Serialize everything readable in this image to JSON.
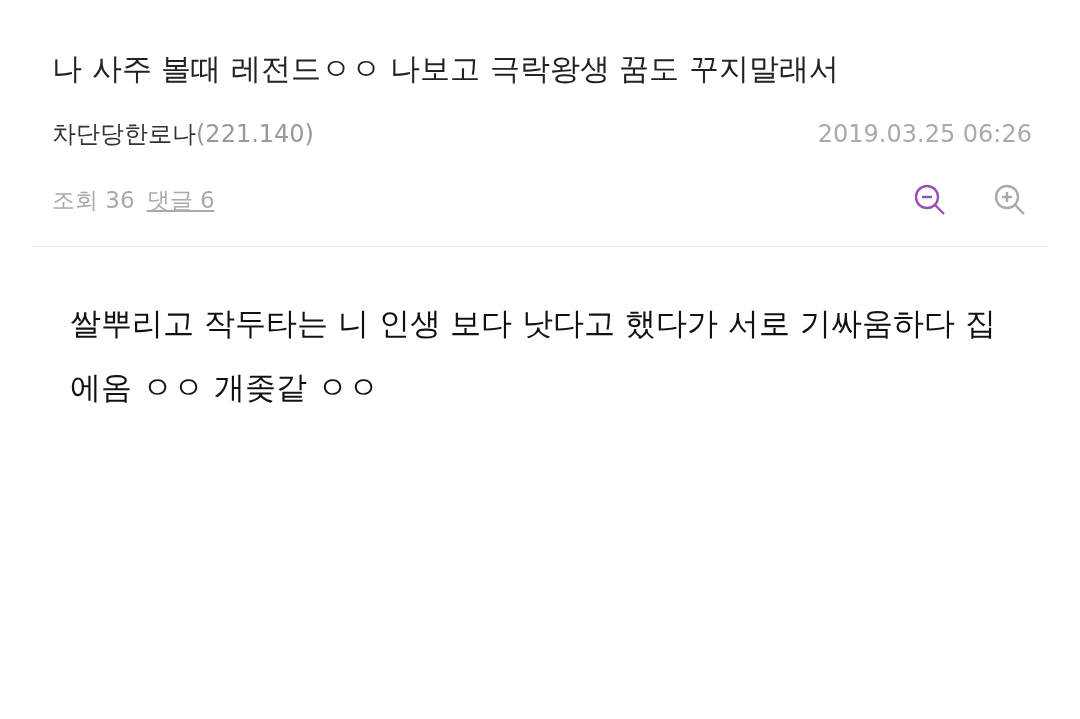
{
  "post": {
    "title": "나 사주 볼때 레전드ㅇㅇ 나보고 극락왕생 꿈도 꾸지말래서",
    "author": "차단당한로나",
    "ip": "(221.140)",
    "date": "2019.03.25 06:26",
    "views_label": "조회 36",
    "comments_link": "댓글 6",
    "body": "쌀뿌리고 작두타는 니 인생 보다 낫다고 했다가 서로 기싸움하다 집에옴 ㅇㅇ 개좆같 ㅇㅇ"
  }
}
